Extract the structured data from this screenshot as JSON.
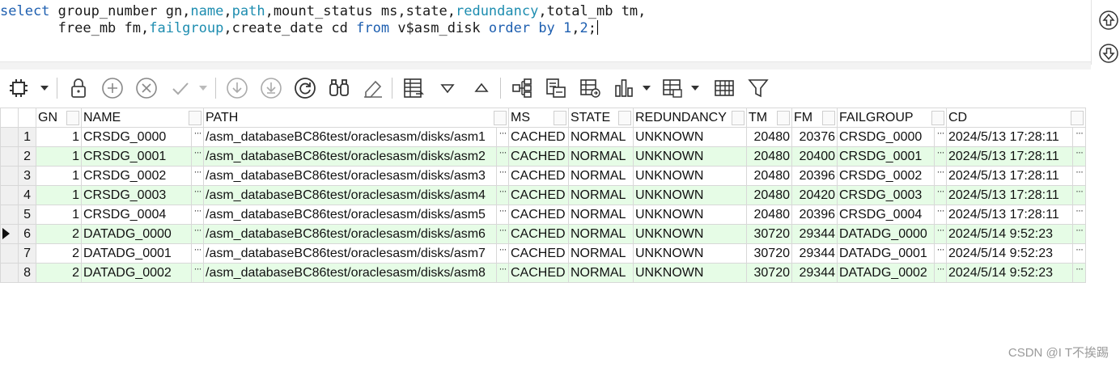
{
  "editor": {
    "line1": {
      "t1": "select",
      "t2": " group_number gn,",
      "t3": "name",
      "t4": ",",
      "t5": "path",
      "t6": ",mount_status ms,state,",
      "t7": "redundancy",
      "t8": ",total_mb tm,"
    },
    "line2": {
      "t1": "       free_mb fm,",
      "t2": "failgroup",
      "t3": ",create_date cd ",
      "t4": "from",
      "t5": " v$asm_disk ",
      "t6": "order by",
      "t7": " ",
      "t8": "1",
      "t9": ",",
      "t10": "2",
      "t11": ";"
    }
  },
  "grid": {
    "columns": [
      "GN",
      "NAME",
      "PATH",
      "MS",
      "STATE",
      "REDUNDANCY",
      "TM",
      "FM",
      "FAILGROUP",
      "CD"
    ],
    "rows": [
      {
        "rn": "1",
        "gn": "1",
        "name": "CRSDG_0000",
        "path": "/asm_databaseBC86test/oraclesasm/disks/asm1",
        "ms": "CACHED",
        "state": "NORMAL",
        "red": "UNKNOWN",
        "tm": "20480",
        "fm": "20376",
        "fg": "CRSDG_0000",
        "cd": "2024/5/13 17:28:11"
      },
      {
        "rn": "2",
        "gn": "1",
        "name": "CRSDG_0001",
        "path": "/asm_databaseBC86test/oraclesasm/disks/asm2",
        "ms": "CACHED",
        "state": "NORMAL",
        "red": "UNKNOWN",
        "tm": "20480",
        "fm": "20400",
        "fg": "CRSDG_0001",
        "cd": "2024/5/13 17:28:11"
      },
      {
        "rn": "3",
        "gn": "1",
        "name": "CRSDG_0002",
        "path": "/asm_databaseBC86test/oraclesasm/disks/asm3",
        "ms": "CACHED",
        "state": "NORMAL",
        "red": "UNKNOWN",
        "tm": "20480",
        "fm": "20396",
        "fg": "CRSDG_0002",
        "cd": "2024/5/13 17:28:11"
      },
      {
        "rn": "4",
        "gn": "1",
        "name": "CRSDG_0003",
        "path": "/asm_databaseBC86test/oraclesasm/disks/asm4",
        "ms": "CACHED",
        "state": "NORMAL",
        "red": "UNKNOWN",
        "tm": "20480",
        "fm": "20420",
        "fg": "CRSDG_0003",
        "cd": "2024/5/13 17:28:11"
      },
      {
        "rn": "5",
        "gn": "1",
        "name": "CRSDG_0004",
        "path": "/asm_databaseBC86test/oraclesasm/disks/asm5",
        "ms": "CACHED",
        "state": "NORMAL",
        "red": "UNKNOWN",
        "tm": "20480",
        "fm": "20396",
        "fg": "CRSDG_0004",
        "cd": "2024/5/13 17:28:11"
      },
      {
        "rn": "6",
        "gn": "2",
        "name": "DATADG_0000",
        "path": "/asm_databaseBC86test/oraclesasm/disks/asm6",
        "ms": "CACHED",
        "state": "NORMAL",
        "red": "UNKNOWN",
        "tm": "30720",
        "fm": "29344",
        "fg": "DATADG_0000",
        "cd": "2024/5/14 9:52:23"
      },
      {
        "rn": "7",
        "gn": "2",
        "name": "DATADG_0001",
        "path": "/asm_databaseBC86test/oraclesasm/disks/asm7",
        "ms": "CACHED",
        "state": "NORMAL",
        "red": "UNKNOWN",
        "tm": "30720",
        "fm": "29344",
        "fg": "DATADG_0001",
        "cd": "2024/5/14 9:52:23"
      },
      {
        "rn": "8",
        "gn": "2",
        "name": "DATADG_0002",
        "path": "/asm_databaseBC86test/oraclesasm/disks/asm8",
        "ms": "CACHED",
        "state": "NORMAL",
        "red": "UNKNOWN",
        "tm": "30720",
        "fm": "29344",
        "fg": "DATADG_0002",
        "cd": "2024/5/14 9:52:23"
      }
    ],
    "ellipsis": "···"
  },
  "watermark": "CSDN @I T不挨踢",
  "colors": {
    "keyword": "#1e5fb0",
    "column": "#1e8db0",
    "alt_row": "#e6fce6"
  }
}
